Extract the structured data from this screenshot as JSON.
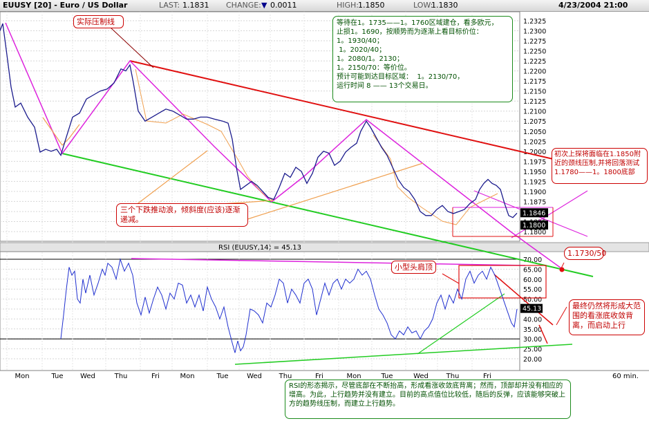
{
  "header": {
    "title": "EUUSY [20] - Euro / US Dollar",
    "last_label": "LAST:",
    "last_value": "1.1831",
    "change_label": "CHANGE:",
    "change_value": "0.0011",
    "high_label": "HIGH:",
    "high_value": "1.1850",
    "low_label": "LOW:",
    "low_value": "1.1830",
    "datetime": "4/23/2004 21:00"
  },
  "chart_data": [
    {
      "type": "line",
      "title": "EUUSY [20] - Euro / US Dollar",
      "ylim": [
        1.1795,
        1.2335
      ],
      "y_ticks": [
        "1.2325",
        "1.2300",
        "1.2275",
        "1.2250",
        "1.2225",
        "1.2200",
        "1.2175",
        "1.2150",
        "1.2125",
        "1.2100",
        "1.2075",
        "1.2050",
        "1.2025",
        "1.2000",
        "1.1975",
        "1.1950",
        "1.1925",
        "1.1900",
        "1.1875",
        "1.1850",
        "1.1825",
        "1.1800"
      ],
      "x_categories": [
        "Mon",
        "Tue",
        "Wed",
        "Thu",
        "Fri",
        "Mon",
        "Tue",
        "Wed",
        "Thu",
        "Fri",
        "Mon",
        "Tue",
        "Wed",
        "Thu",
        "Fri"
      ],
      "price_points": [
        [
          0,
          1.23
        ],
        [
          4,
          1.2318
        ],
        [
          10,
          1.224
        ],
        [
          16,
          1.216
        ],
        [
          22,
          1.211
        ],
        [
          30,
          1.212
        ],
        [
          40,
          1.2085
        ],
        [
          50,
          1.206
        ],
        [
          58,
          1.1998
        ],
        [
          66,
          1.2005
        ],
        [
          74,
          1.2
        ],
        [
          82,
          1.2005
        ],
        [
          88,
          1.199
        ],
        [
          95,
          1.203
        ],
        [
          105,
          1.2085
        ],
        [
          115,
          1.2095
        ],
        [
          125,
          1.213
        ],
        [
          135,
          1.214
        ],
        [
          145,
          1.215
        ],
        [
          155,
          1.2155
        ],
        [
          165,
          1.217
        ],
        [
          175,
          1.2205
        ],
        [
          182,
          1.22
        ],
        [
          188,
          1.2215
        ],
        [
          193,
          1.217
        ],
        [
          200,
          1.21
        ],
        [
          210,
          1.2075
        ],
        [
          220,
          1.2085
        ],
        [
          230,
          1.2095
        ],
        [
          240,
          1.2105
        ],
        [
          250,
          1.21
        ],
        [
          260,
          1.209
        ],
        [
          270,
          1.208
        ],
        [
          280,
          1.208
        ],
        [
          290,
          1.2085
        ],
        [
          300,
          1.2085
        ],
        [
          310,
          1.208
        ],
        [
          322,
          1.2075
        ],
        [
          330,
          1.207
        ],
        [
          336,
          1.203
        ],
        [
          342,
          1.196
        ],
        [
          348,
          1.1905
        ],
        [
          356,
          1.1915
        ],
        [
          364,
          1.1925
        ],
        [
          372,
          1.1915
        ],
        [
          380,
          1.19
        ],
        [
          388,
          1.1885
        ],
        [
          396,
          1.188
        ],
        [
          404,
          1.191
        ],
        [
          412,
          1.1945
        ],
        [
          420,
          1.1935
        ],
        [
          428,
          1.196
        ],
        [
          436,
          1.195
        ],
        [
          444,
          1.192
        ],
        [
          452,
          1.1945
        ],
        [
          460,
          1.1985
        ],
        [
          468,
          1.2
        ],
        [
          476,
          1.1995
        ],
        [
          484,
          1.1965
        ],
        [
          492,
          1.1975
        ],
        [
          500,
          1.1998
        ],
        [
          508,
          1.201
        ],
        [
          516,
          1.202
        ],
        [
          522,
          1.205
        ],
        [
          530,
          1.2075
        ],
        [
          536,
          1.206
        ],
        [
          544,
          1.2035
        ],
        [
          552,
          1.201
        ],
        [
          560,
          1.199
        ],
        [
          568,
          1.196
        ],
        [
          576,
          1.193
        ],
        [
          584,
          1.191
        ],
        [
          592,
          1.19
        ],
        [
          600,
          1.188
        ],
        [
          608,
          1.185
        ],
        [
          616,
          1.184
        ],
        [
          624,
          1.184
        ],
        [
          632,
          1.1855
        ],
        [
          640,
          1.1865
        ],
        [
          648,
          1.185
        ],
        [
          656,
          1.1845
        ],
        [
          664,
          1.185
        ],
        [
          672,
          1.1855
        ],
        [
          680,
          1.187
        ],
        [
          688,
          1.188
        ],
        [
          694,
          1.1905
        ],
        [
          700,
          1.192
        ],
        [
          706,
          1.193
        ],
        [
          712,
          1.192
        ],
        [
          718,
          1.1915
        ],
        [
          724,
          1.1905
        ],
        [
          730,
          1.187
        ],
        [
          736,
          1.184
        ],
        [
          742,
          1.1835
        ],
        [
          748,
          1.1846
        ]
      ],
      "last_price_tag": "1.1846",
      "low_price_tag": "1.1800"
    },
    {
      "type": "line",
      "title": "RSI (EUUSY,14) = 45.13",
      "ylim": [
        15,
        75
      ],
      "y_ticks": [
        "70.00",
        "65.00",
        "60.00",
        "55.00",
        "50.00",
        "45.00",
        "40.00",
        "35.00",
        "30.00",
        "25.00",
        "20.00"
      ],
      "rsi_points": [
        [
          88,
          30
        ],
        [
          92,
          42
        ],
        [
          96,
          55
        ],
        [
          100,
          66
        ],
        [
          104,
          62
        ],
        [
          108,
          64
        ],
        [
          112,
          50
        ],
        [
          116,
          48
        ],
        [
          120,
          60
        ],
        [
          124,
          53
        ],
        [
          130,
          62
        ],
        [
          136,
          52
        ],
        [
          142,
          58
        ],
        [
          148,
          65
        ],
        [
          152,
          62
        ],
        [
          156,
          68
        ],
        [
          162,
          66
        ],
        [
          168,
          60
        ],
        [
          174,
          70
        ],
        [
          180,
          64
        ],
        [
          186,
          68
        ],
        [
          192,
          62
        ],
        [
          198,
          48
        ],
        [
          204,
          42
        ],
        [
          210,
          51
        ],
        [
          216,
          43
        ],
        [
          222,
          50
        ],
        [
          228,
          56
        ],
        [
          234,
          52
        ],
        [
          240,
          45
        ],
        [
          246,
          53
        ],
        [
          252,
          50
        ],
        [
          258,
          58
        ],
        [
          264,
          57
        ],
        [
          270,
          48
        ],
        [
          276,
          52
        ],
        [
          282,
          46
        ],
        [
          288,
          52
        ],
        [
          294,
          44
        ],
        [
          300,
          56
        ],
        [
          306,
          50
        ],
        [
          312,
          46
        ],
        [
          318,
          40
        ],
        [
          324,
          46
        ],
        [
          330,
          36
        ],
        [
          336,
          28
        ],
        [
          340,
          23
        ],
        [
          344,
          29
        ],
        [
          348,
          24
        ],
        [
          352,
          26
        ],
        [
          356,
          32
        ],
        [
          362,
          45
        ],
        [
          368,
          44
        ],
        [
          374,
          42
        ],
        [
          380,
          38
        ],
        [
          386,
          48
        ],
        [
          392,
          46
        ],
        [
          398,
          52
        ],
        [
          404,
          60
        ],
        [
          410,
          58
        ],
        [
          416,
          48
        ],
        [
          422,
          55
        ],
        [
          428,
          52
        ],
        [
          434,
          48
        ],
        [
          440,
          58
        ],
        [
          446,
          60
        ],
        [
          452,
          55
        ],
        [
          458,
          42
        ],
        [
          464,
          50
        ],
        [
          470,
          58
        ],
        [
          476,
          52
        ],
        [
          482,
          58
        ],
        [
          488,
          60
        ],
        [
          494,
          55
        ],
        [
          500,
          60
        ],
        [
          506,
          58
        ],
        [
          512,
          60
        ],
        [
          518,
          65
        ],
        [
          524,
          62
        ],
        [
          530,
          64
        ],
        [
          536,
          60
        ],
        [
          542,
          52
        ],
        [
          548,
          45
        ],
        [
          554,
          42
        ],
        [
          560,
          38
        ],
        [
          566,
          32
        ],
        [
          572,
          30
        ],
        [
          578,
          34
        ],
        [
          584,
          32
        ],
        [
          590,
          36
        ],
        [
          596,
          33
        ],
        [
          602,
          34
        ],
        [
          608,
          30
        ],
        [
          614,
          34
        ],
        [
          620,
          36
        ],
        [
          626,
          40
        ],
        [
          632,
          48
        ],
        [
          638,
          52
        ],
        [
          644,
          45
        ],
        [
          650,
          52
        ],
        [
          656,
          48
        ],
        [
          662,
          55
        ],
        [
          668,
          50
        ],
        [
          674,
          60
        ],
        [
          680,
          64
        ],
        [
          686,
          58
        ],
        [
          692,
          62
        ],
        [
          698,
          64
        ],
        [
          704,
          60
        ],
        [
          710,
          66
        ],
        [
          716,
          62
        ],
        [
          722,
          56
        ],
        [
          728,
          50
        ],
        [
          734,
          44
        ],
        [
          740,
          38
        ],
        [
          744,
          36
        ],
        [
          748,
          45
        ]
      ],
      "last_value_tag": "45.13"
    }
  ],
  "axes_labels": {
    "rsi_title": "RSI (EUUSY,14) = 45.13",
    "timeframe": "60 min."
  },
  "annotations": {
    "plan": "等待在1。1735——1。1760区域建仓，看多欧元，\n止损1。1690，按顺势而为逐渐上看目标价位：\n1。1930/40；\n 1。2020/40；\n1。2080/1。2130；\n1。2150/70：等价位。\n预计可能到达目标区域：  1。2130/70，\n运行时间 8 —— 13个交易日。",
    "neckline": "初次上探将面临在1.1850附近的颈线压制,并将回落测试  1.1780——1。1800底部",
    "waves": "三个下跌推动浪，倾斜度(应该)逐渐递减。",
    "rsi_note": "RSI的形态揭示，尽管底部在不断抬高，形成看涨收敛底背离；然而，顶部却并没有相应的增高。为此，上行趋势并没有建立。目前的高点值位比较低，随后的反弹，应该能够突破上方的趋势线压制，而建立上行趋势。",
    "final_note": "最终仍然将形成大范围的看涨底收敛背离，而启动上行",
    "resistance": "实际压制线",
    "head_shoulders": "小型头肩顶",
    "target": "1.1730/50"
  },
  "colors": {
    "price": "#1a1a8c",
    "rsi": "#1f2fcf",
    "resistance_line": "#e01010",
    "support_line": "#22cc22",
    "magenta_line": "#dd22dd",
    "wave_line": "#f0a050",
    "annotation_red": "#cc0000",
    "annotation_green": "#1a8a1a"
  }
}
